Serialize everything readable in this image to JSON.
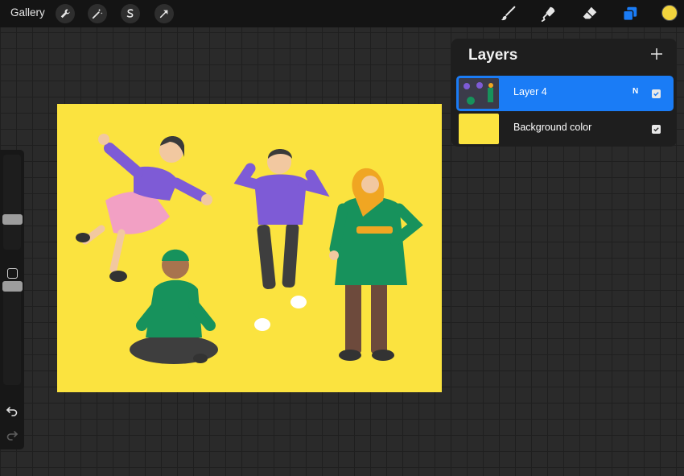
{
  "app": {
    "gallery_label": "Gallery"
  },
  "toolbar": {
    "left_tools": [
      "wrench-icon",
      "magic-wand-icon",
      "selection-icon",
      "transform-arrow-icon"
    ],
    "right_tools": [
      "brush-icon",
      "smudge-icon",
      "eraser-icon",
      "layers-icon"
    ],
    "active_color": "#f2d43d",
    "layers_accent": "#1a7cf6"
  },
  "sidebar": {
    "brush_size_level": 0.3,
    "opacity_level": 0.2,
    "undo_icon": "undo-icon",
    "redo_icon": "redo-icon"
  },
  "canvas": {
    "background": "#fbe33f",
    "illustration": "four 3D cartoon characters"
  },
  "layers_panel": {
    "title": "Layers",
    "add_icon": "plus-icon",
    "layers": [
      {
        "name": "Layer 4",
        "blend": "N",
        "visible": true,
        "selected": true
      },
      {
        "name": "Background color",
        "blend": "",
        "visible": true,
        "selected": false
      }
    ]
  }
}
